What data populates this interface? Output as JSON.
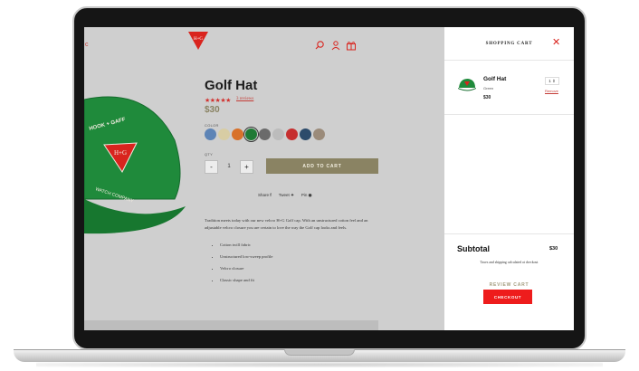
{
  "header": {
    "logo_text": "H+G",
    "left_mark": "c"
  },
  "product": {
    "title": "Golf Hat",
    "stars": "★★★★★",
    "reviews": "3 reviews",
    "price": "$30",
    "color_label": "COLOR",
    "qty_label": "QTY",
    "qty_minus": "-",
    "qty_value": "1",
    "qty_plus": "+",
    "add_to_cart": "ADD TO CART",
    "swatches": [
      "#5d84b6",
      "#d8cda4",
      "#d8712a",
      "#1f7a35",
      "#6b6b6b",
      "#bcbcbc",
      "#c62f2f",
      "#2c4b6b",
      "#9b8b7a"
    ],
    "share": {
      "share": "Share",
      "tweet": "Tweet",
      "pin": "Pin"
    },
    "description": "Tradition meets today with our new velcro H+G Golf cap. With an unstructured cotton feel and an adjustable velcro closure you are certain to love the way the Golf cap looks and feels.",
    "features": [
      "Cotton twill fabric",
      "Unstructured low-sweep profile",
      "Velcro closure",
      "Classic shape and fit"
    ]
  },
  "cart": {
    "title": "SHOPPING CART",
    "close": "✕",
    "item": {
      "name": "Golf Hat",
      "variant": "Green",
      "price": "$30",
      "qty": "1 ⇕",
      "remove": "Remove"
    },
    "subtotal_label": "Subtotal",
    "subtotal_value": "$30",
    "tax_note": "Taxes and shipping calculated at checkout",
    "review_cart": "REVIEW CART",
    "checkout": "CHECKOUT"
  },
  "colors": {
    "accent_red": "#ee1c1c",
    "olive": "#8a8363",
    "hat_green": "#1f8a3b",
    "overlay_gray": "#cfcfcf"
  }
}
